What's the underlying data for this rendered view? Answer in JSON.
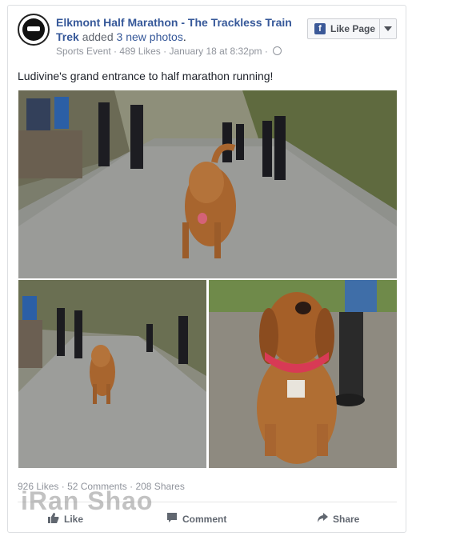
{
  "post": {
    "page_name": "Elkmont Half Marathon - The Trackless Train Trek",
    "added_text": "added",
    "photo_count_link": "3 new photos",
    "period": ".",
    "category": "Sports Event",
    "likes": "489 Likes",
    "date": "January 18 at 8:32pm",
    "meta_sep": "·",
    "message": "Ludivine's grand entrance to half marathon running!"
  },
  "like_page_button": {
    "label": "Like Page",
    "icon": "facebook-f-icon"
  },
  "stats": {
    "likes": "926 Likes",
    "comments": "52 Comments",
    "shares": "208 Shares",
    "sep": "·"
  },
  "actions": {
    "like": "Like",
    "comment": "Comment",
    "share": "Share"
  },
  "watermark": "iRan Shao",
  "colors": {
    "link": "#365899",
    "meta": "#90949c",
    "fb_blue": "#3b5998"
  }
}
